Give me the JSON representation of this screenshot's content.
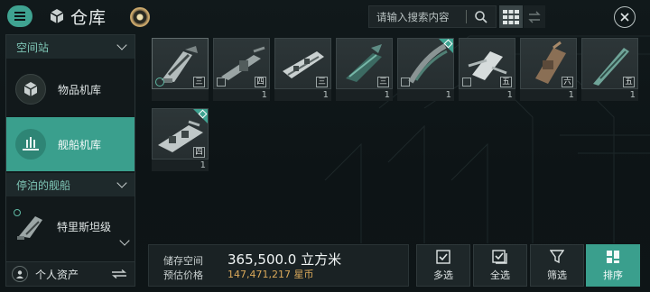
{
  "header": {
    "title": "仓库",
    "search_placeholder": "请输入搜索内容"
  },
  "sidebar": {
    "section_station": "空间站",
    "items": [
      {
        "label": "物品机库",
        "icon": "cube-icon",
        "active": false
      },
      {
        "label": "舰船机库",
        "icon": "ship-hangar-icon",
        "active": true
      }
    ],
    "section_docked": "停泊的舰船",
    "docked_ship": "特里斯坦级",
    "personal_assets": "个人资产"
  },
  "items": [
    {
      "tier": "三",
      "qty": "",
      "badge": "round",
      "corner": false
    },
    {
      "tier": "四",
      "qty": "1",
      "badge": "square",
      "corner": false
    },
    {
      "tier": "三",
      "qty": "1",
      "badge": "",
      "corner": false
    },
    {
      "tier": "三",
      "qty": "1",
      "badge": "",
      "corner": false
    },
    {
      "tier": "",
      "qty": "1",
      "badge": "square",
      "corner": true
    },
    {
      "tier": "五",
      "qty": "1",
      "badge": "square",
      "corner": false
    },
    {
      "tier": "六",
      "qty": "1",
      "badge": "",
      "corner": false
    },
    {
      "tier": "五",
      "qty": "1",
      "badge": "",
      "corner": false
    },
    {
      "tier": "四",
      "qty": "1",
      "badge": "",
      "corner": true
    }
  ],
  "storage": {
    "space_label": "储存空间",
    "space_value": "365,500.0 立方米",
    "price_label": "预估价格",
    "price_value": "147,471,217 星币"
  },
  "actions": {
    "multi": "多选",
    "all": "全选",
    "filter": "筛选",
    "sort": "排序"
  },
  "colors": {
    "accent": "#3a9f8d",
    "price": "#d9a85a"
  }
}
